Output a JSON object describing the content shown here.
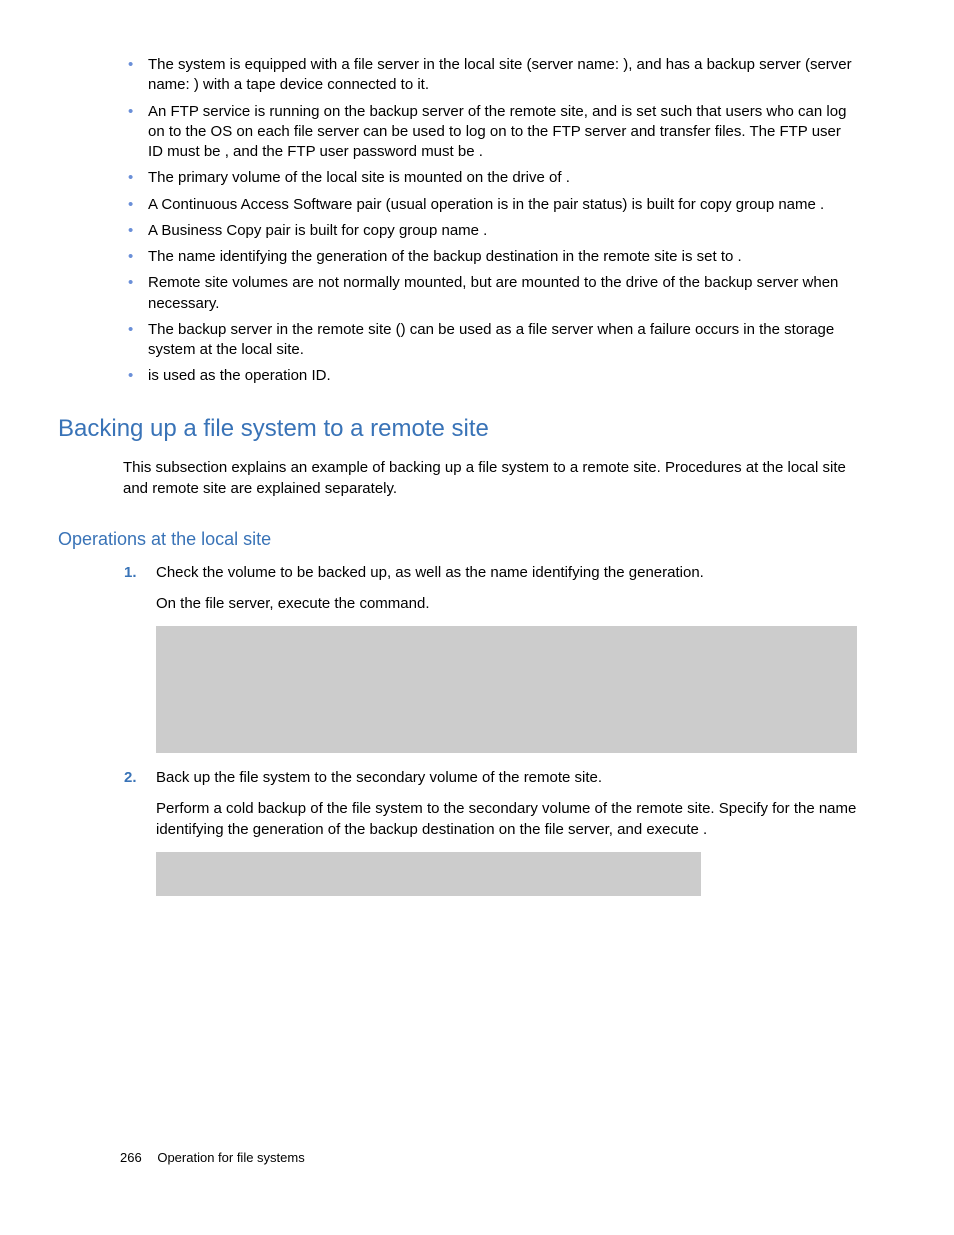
{
  "bullets": [
    {
      "text_a": "The system is equipped with a file server in the local site (server name: ",
      "blank_a": "",
      "text_b": "), and has a backup server (server name: ",
      "blank_b": "",
      "text_c": ") with a tape device connected to it."
    },
    {
      "text_a": "An FTP service is running on the backup server of the remote site, and is set such that users who can log on to the OS on each file server can be used to log on to the FTP server and transfer files. The FTP user ID must be ",
      "blank_a": "",
      "text_b": ", and the FTP user password must be ",
      "blank_b": "",
      "text_c": "."
    },
    {
      "text_a": "The primary volume of the local site is mounted on the ",
      "blank_a": "",
      "text_b": " drive of ",
      "blank_b": "",
      "text_c": "."
    },
    {
      "text_a": "A Continuous Access Software pair (usual operation is in the pair status) is built for copy group name ",
      "blank_a": "",
      "text_b": "",
      "blank_b": "",
      "text_c": "."
    },
    {
      "text_a": "A Business Copy pair is built for copy group name ",
      "blank_a": "",
      "text_b": "",
      "blank_b": "",
      "text_c": "."
    },
    {
      "text_a": "The name identifying the generation of the backup destination in the remote site is set to ",
      "blank_a": "",
      "text_b": "",
      "blank_b": "",
      "text_c": "."
    },
    {
      "text_a": "Remote site volumes are not normally mounted, but are mounted to the ",
      "blank_a": "",
      "text_b": " drive of the backup server when necessary.",
      "blank_b": "",
      "text_c": ""
    },
    {
      "text_a": "The backup server in the remote site (",
      "blank_a": "",
      "text_b": ") can be used as a file server when a failure occurs in the storage system at the local site.",
      "blank_b": "",
      "text_c": ""
    },
    {
      "text_a": "",
      "blank_a": "",
      "text_b": " is used as the operation ID.",
      "blank_b": "",
      "text_c": ""
    }
  ],
  "heading1": "Backing up a file system to a remote site",
  "intro": "This subsection explains an example of backing up a file system to a remote site. Procedures at the local site and remote site are explained separately.",
  "heading2": "Operations at the local site",
  "steps": [
    {
      "title": "Check the volume to be backed up, as well as the name identifying the generation.",
      "body_a": "On the file server, execute the ",
      "body_blank1": "",
      "body_b": " command.",
      "codebox": 1
    },
    {
      "title": "Back up the file system to the secondary volume of the remote site.",
      "body_a": "Perform a cold backup of the file system to the secondary volume of the remote site. Specify ",
      "body_blank1": "",
      "body_b": " for the name identifying the generation of the backup destination on the file server, and execute ",
      "body_blank2": "",
      "body_c": ".",
      "codebox": 2
    }
  ],
  "footer": {
    "page": "266",
    "title": "Operation for file systems"
  }
}
